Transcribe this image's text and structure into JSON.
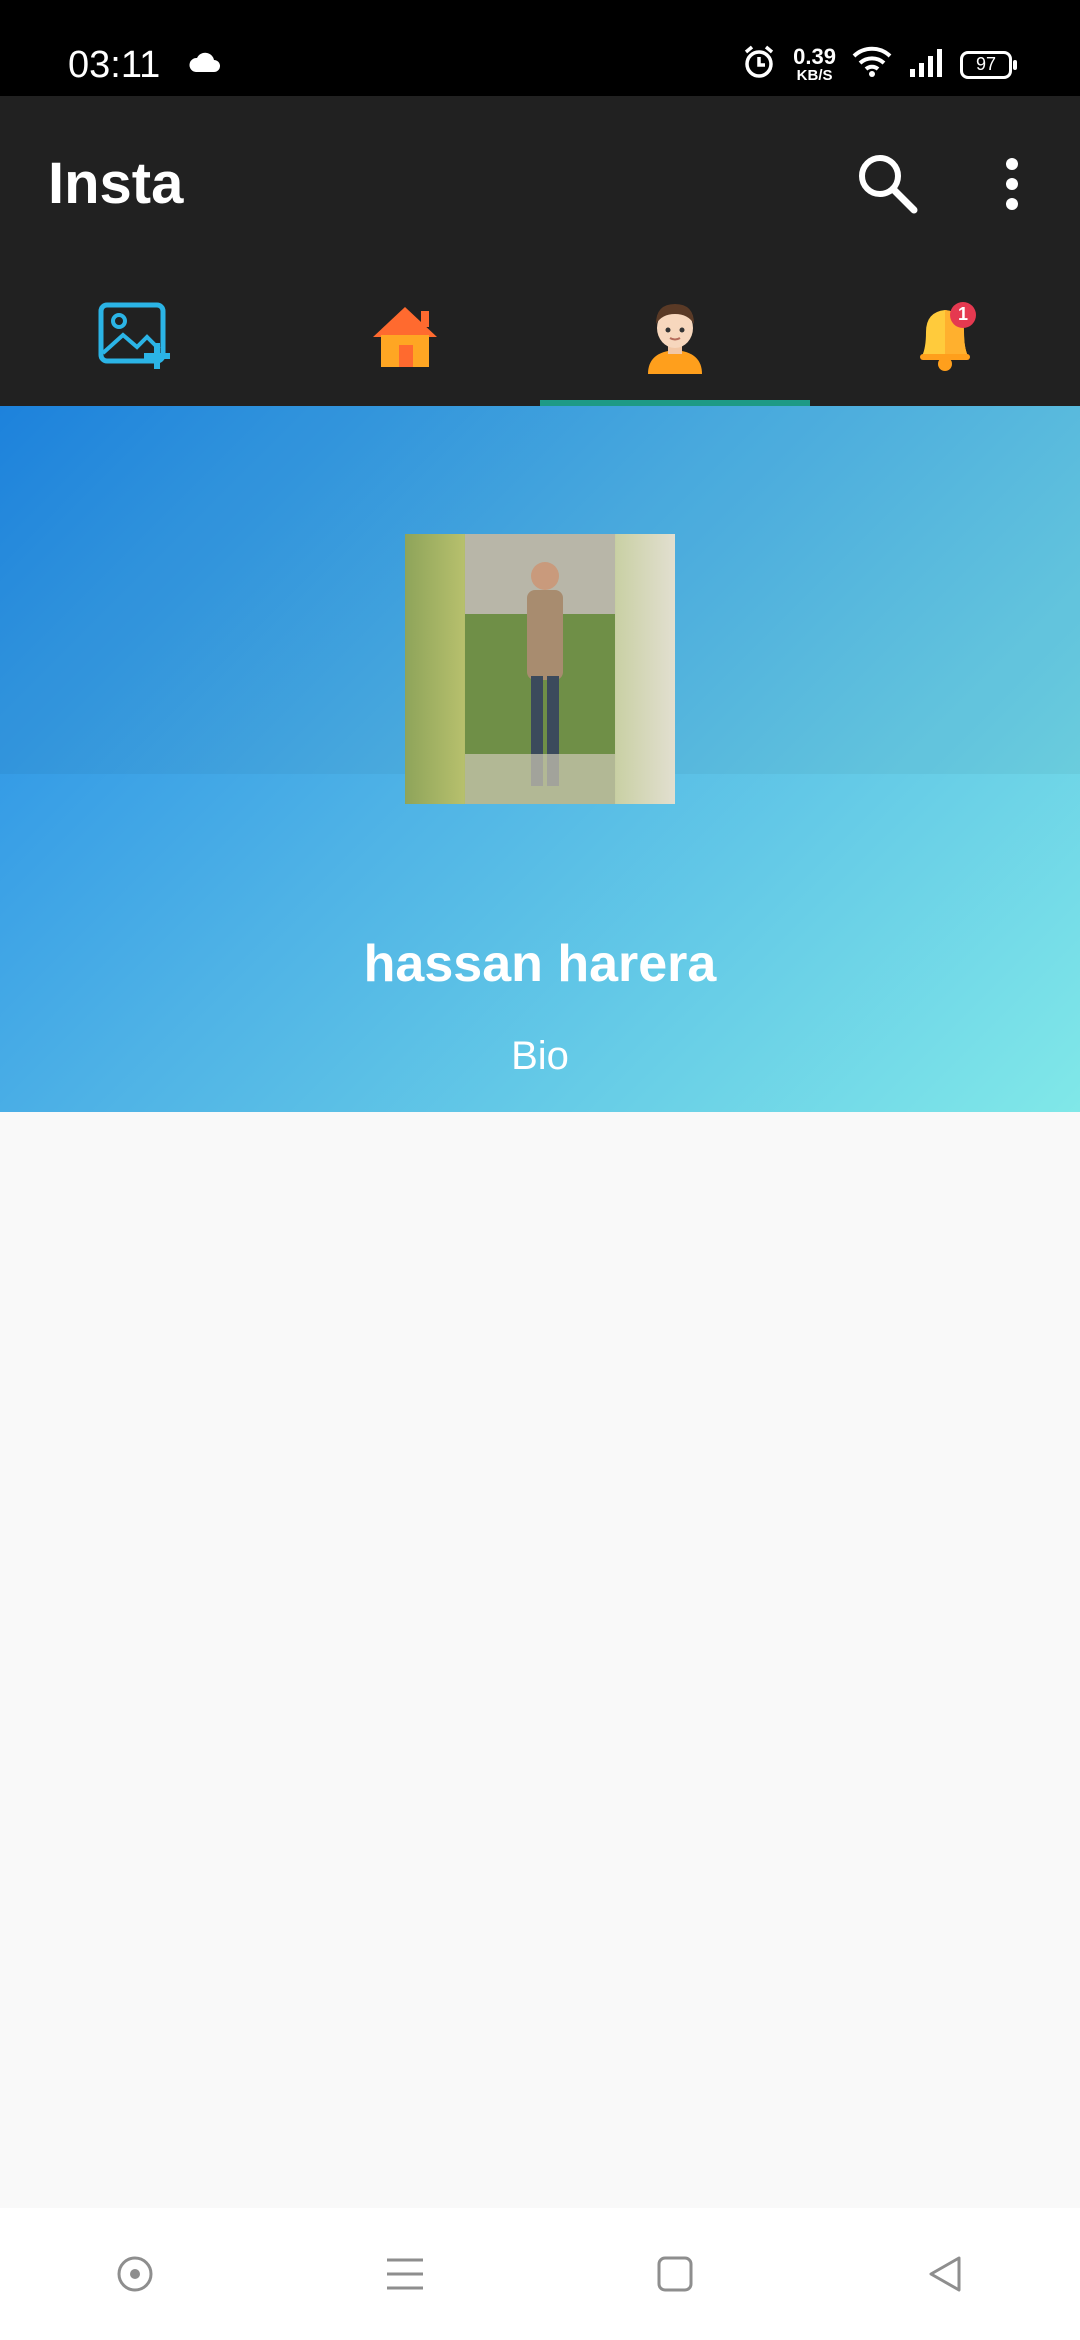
{
  "status_bar": {
    "time": "03:11",
    "net_speed_value": "0.39",
    "net_speed_unit": "KB/S",
    "battery": "97",
    "icons": [
      "cloud-icon",
      "alarm-icon",
      "wifi-icon",
      "signal-icon",
      "battery-icon"
    ]
  },
  "app_bar": {
    "title": "Insta",
    "actions": [
      "search-icon",
      "more-vert-icon"
    ]
  },
  "tabs": [
    {
      "name": "add-photo",
      "icon": "add-photo-icon",
      "active": false
    },
    {
      "name": "home",
      "icon": "home-icon",
      "active": false
    },
    {
      "name": "profile",
      "icon": "profile-avatar-icon",
      "active": true
    },
    {
      "name": "notifications",
      "icon": "bell-icon",
      "active": false,
      "badge": "1"
    }
  ],
  "profile": {
    "name": "hassan harera",
    "bio": "Bio"
  },
  "colors": {
    "app_bar": "#212121",
    "tab_indicator": "#1e9a86",
    "gradient_start": "#1f88e5",
    "gradient_end": "#80e8e8",
    "badge": "#e53950"
  },
  "nav_bar": {
    "buttons": [
      "assistant-circle-icon",
      "menu-lines-icon",
      "home-square-icon",
      "back-triangle-icon"
    ]
  }
}
